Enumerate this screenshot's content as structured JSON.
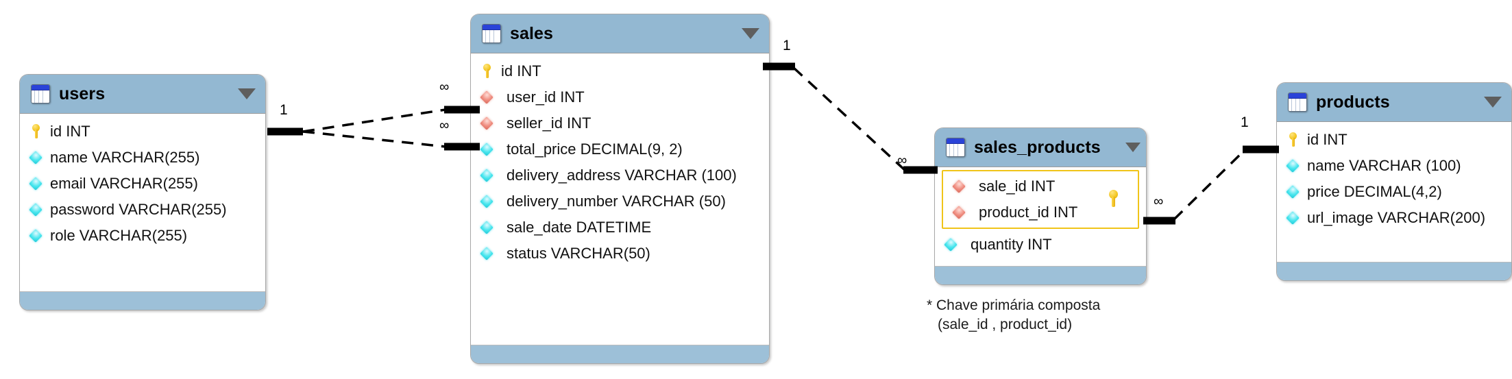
{
  "diagram": {
    "type": "entity-relationship-diagram",
    "title": "",
    "colors": {
      "header": "#93b8d2",
      "footer": "#9dc0d8",
      "border": "#a8a8a8",
      "pk_group_border": "#f0c419",
      "key_icon": "#f0c012",
      "pk_diamond": "#49e6ee",
      "fk_diamond": "#ef8d80",
      "connector": "#000000",
      "background": "#ffffff"
    }
  },
  "tables": [
    {
      "name": "users",
      "icon": "table-icon",
      "collapse_icon": "chevron-down-icon",
      "columns": [
        {
          "label": "id INT",
          "icon": "key-icon"
        },
        {
          "label": "name VARCHAR(255)",
          "icon": "diamond-cyan-icon"
        },
        {
          "label": "email VARCHAR(255)",
          "icon": "diamond-cyan-icon"
        },
        {
          "label": "password VARCHAR(255)",
          "icon": "diamond-cyan-icon"
        },
        {
          "label": "role VARCHAR(255)",
          "icon": "diamond-cyan-icon"
        }
      ]
    },
    {
      "name": "sales",
      "icon": "table-icon",
      "collapse_icon": "chevron-down-icon",
      "columns": [
        {
          "label": "id INT",
          "icon": "key-icon"
        },
        {
          "label": "user_id INT",
          "icon": "diamond-red-icon"
        },
        {
          "label": "seller_id INT",
          "icon": "diamond-red-icon"
        },
        {
          "label": "total_price DECIMAL(9, 2)",
          "icon": "diamond-cyan-icon"
        },
        {
          "label": "delivery_address VARCHAR (100)",
          "icon": "diamond-cyan-icon"
        },
        {
          "label": "delivery_number VARCHAR (50)",
          "icon": "diamond-cyan-icon"
        },
        {
          "label": "sale_date DATETIME",
          "icon": "diamond-cyan-icon"
        },
        {
          "label": "status VARCHAR(50)",
          "icon": "diamond-cyan-icon"
        }
      ]
    },
    {
      "name": "sales_products",
      "icon": "table-icon",
      "collapse_icon": "chevron-down-icon",
      "composite_key_columns": [
        {
          "label": "sale_id INT",
          "icon": "diamond-red-icon"
        },
        {
          "label": "product_id INT",
          "icon": "diamond-red-icon"
        }
      ],
      "composite_key_icon": "key-icon",
      "columns": [
        {
          "label": "quantity INT",
          "icon": "diamond-cyan-icon"
        }
      ]
    },
    {
      "name": "products",
      "icon": "table-icon",
      "collapse_icon": "chevron-down-icon",
      "columns": [
        {
          "label": "id INT",
          "icon": "key-icon"
        },
        {
          "label": "name VARCHAR (100)",
          "icon": "diamond-cyan-icon"
        },
        {
          "label": "price DECIMAL(4,2)",
          "icon": "diamond-cyan-icon"
        },
        {
          "label": "url_image VARCHAR(200)",
          "icon": "diamond-cyan-icon"
        }
      ]
    }
  ],
  "relationships": [
    {
      "from": "users.id",
      "to": "sales.user_id",
      "from_cardinality": "1",
      "to_cardinality": "∞"
    },
    {
      "from": "users.id",
      "to": "sales.seller_id",
      "from_cardinality": "1",
      "to_cardinality": "∞"
    },
    {
      "from": "sales.id",
      "to": "sales_products.sale_id",
      "from_cardinality": "1",
      "to_cardinality": "∞"
    },
    {
      "from": "sales_products.product_id",
      "to": "products.id",
      "from_cardinality": "∞",
      "to_cardinality": "1"
    }
  ],
  "cardinality_labels": {
    "users_one": "1",
    "sales_user_many": "∞",
    "sales_seller_many": "∞",
    "sales_one": "1",
    "sales_products_many": "∞",
    "sales_products_many2": "∞",
    "products_one": "1"
  },
  "footnote": {
    "line1": "* Chave primária composta",
    "line2": "(sale_id , product_id)"
  }
}
